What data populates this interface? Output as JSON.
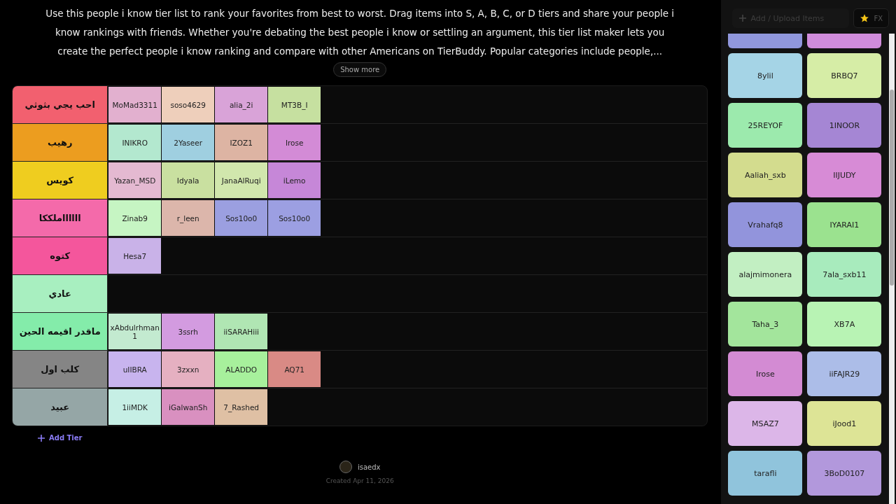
{
  "description": "Use this people i know tier list to rank your favorites from best to worst. Drag items into S, A, B, C, or D tiers and share your people i know rankings with friends. Whether you're debating the best people i know or settling an argument, this tier list maker lets you create the perfect people i know ranking and compare with other Americans on TierBuddy. Popular categories include people,...",
  "show_more": "Show more",
  "tiers": [
    {
      "label": "احب يجي بثوثي",
      "color": "#f2606f",
      "items": [
        {
          "name": "MoMad3311",
          "color": "#e2b0cf"
        },
        {
          "name": "soso4629",
          "color": "#eecfbb"
        },
        {
          "name": "alia_2i",
          "color": "#d9a3d8"
        },
        {
          "name": "MT3B_I",
          "color": "#c6e0a0"
        }
      ]
    },
    {
      "label": "رهيب",
      "color": "#ec9d1f",
      "items": [
        {
          "name": "INIKRO",
          "color": "#b3e8cf"
        },
        {
          "name": "2Yaseer",
          "color": "#9fcfe0"
        },
        {
          "name": "IZOZ1",
          "color": "#ddb4a3"
        },
        {
          "name": "Irose",
          "color": "#d38bd6"
        }
      ]
    },
    {
      "label": "كويس",
      "color": "#efcd1f",
      "items": [
        {
          "name": "Yazan_MSD",
          "color": "#e4b9d1"
        },
        {
          "name": "Idyala",
          "color": "#c9e0a0"
        },
        {
          "name": "JanaAlRuqi",
          "color": "#d1e7ad"
        },
        {
          "name": "iLemo",
          "color": "#c687d8"
        }
      ]
    },
    {
      "label": "ملككاllllll",
      "color": "#f46aaa",
      "items": [
        {
          "name": "Zinab9",
          "color": "#c6f5c3"
        },
        {
          "name": "r_leen",
          "color": "#dcb6ab"
        },
        {
          "name": "Sos10o0",
          "color": "#9b9fe0"
        },
        {
          "name": "Sos10o0",
          "color": "#9c9fe2"
        }
      ]
    },
    {
      "label": "كتوه",
      "color": "#f4569c",
      "items": [
        {
          "name": "Hesa7",
          "color": "#c9b2e8"
        }
      ]
    },
    {
      "label": "عادي",
      "color": "#a8efc0"
    },
    {
      "label": "ماقدر اقيمه الحين",
      "color": "#84ecaa",
      "items": [
        {
          "name": "xAbdulrhman1",
          "color": "#c3ead0"
        },
        {
          "name": "3ssrh",
          "color": "#d39be0"
        },
        {
          "name": "iiSARAHiii",
          "color": "#b0e6b3"
        }
      ]
    },
    {
      "label": "كلب اول",
      "color": "#858585",
      "items": [
        {
          "name": "uIIBRA",
          "color": "#c8b4ee"
        },
        {
          "name": "3zxxn",
          "color": "#e5b0c1"
        },
        {
          "name": "ALADDO",
          "color": "#a7f09c"
        },
        {
          "name": "AQ71",
          "color": "#d98a85"
        }
      ]
    },
    {
      "label": "عبيد",
      "color": "#95a6a6",
      "items": [
        {
          "name": "1iiMDK",
          "color": "#c6efe5"
        },
        {
          "name": "iGalwanSh",
          "color": "#d990c0"
        },
        {
          "name": "7_Rashed",
          "color": "#dfc0a4"
        }
      ]
    }
  ],
  "add_tier": "Add Tier",
  "author": "isaedx",
  "created": "Created Apr 11, 2026",
  "sidebar": {
    "upload": {
      "placeholder": "Add / Upload Items"
    },
    "fx_button": "FX",
    "items": [
      {
        "color": "#9097dc"
      },
      {
        "color": "#d08cdb"
      },
      {
        "name": "8ylil",
        "color": "#a5d4e6"
      },
      {
        "name": "BRBQ7",
        "color": "#d6eda6"
      },
      {
        "name": "25REYOF",
        "color": "#9ceaad"
      },
      {
        "name": "1INOOR",
        "color": "#a586d4"
      },
      {
        "name": "Aaliah_sxb",
        "color": "#d3dc8e"
      },
      {
        "name": "IIJUDY",
        "color": "#d78bd6"
      },
      {
        "name": "Vrahafq8",
        "color": "#9294dc"
      },
      {
        "name": "IYARAI1",
        "color": "#9be28f"
      },
      {
        "name": "alajmimonera",
        "color": "#c2efc2"
      },
      {
        "name": "7ala_sxb11",
        "color": "#a8ebbd"
      },
      {
        "name": "Taha_3",
        "color": "#a3e59c"
      },
      {
        "name": "XB7A",
        "color": "#b8f3b4"
      },
      {
        "name": "Irose",
        "color": "#d38bd3"
      },
      {
        "name": "iiFAJR29",
        "color": "#acbde8"
      },
      {
        "name": "MSAZ7",
        "color": "#dcb6e8"
      },
      {
        "name": "iJood1",
        "color": "#dde496"
      },
      {
        "name": "tarafli",
        "color": "#90c4dc"
      },
      {
        "name": "3BoD0107",
        "color": "#b298dc"
      }
    ]
  }
}
